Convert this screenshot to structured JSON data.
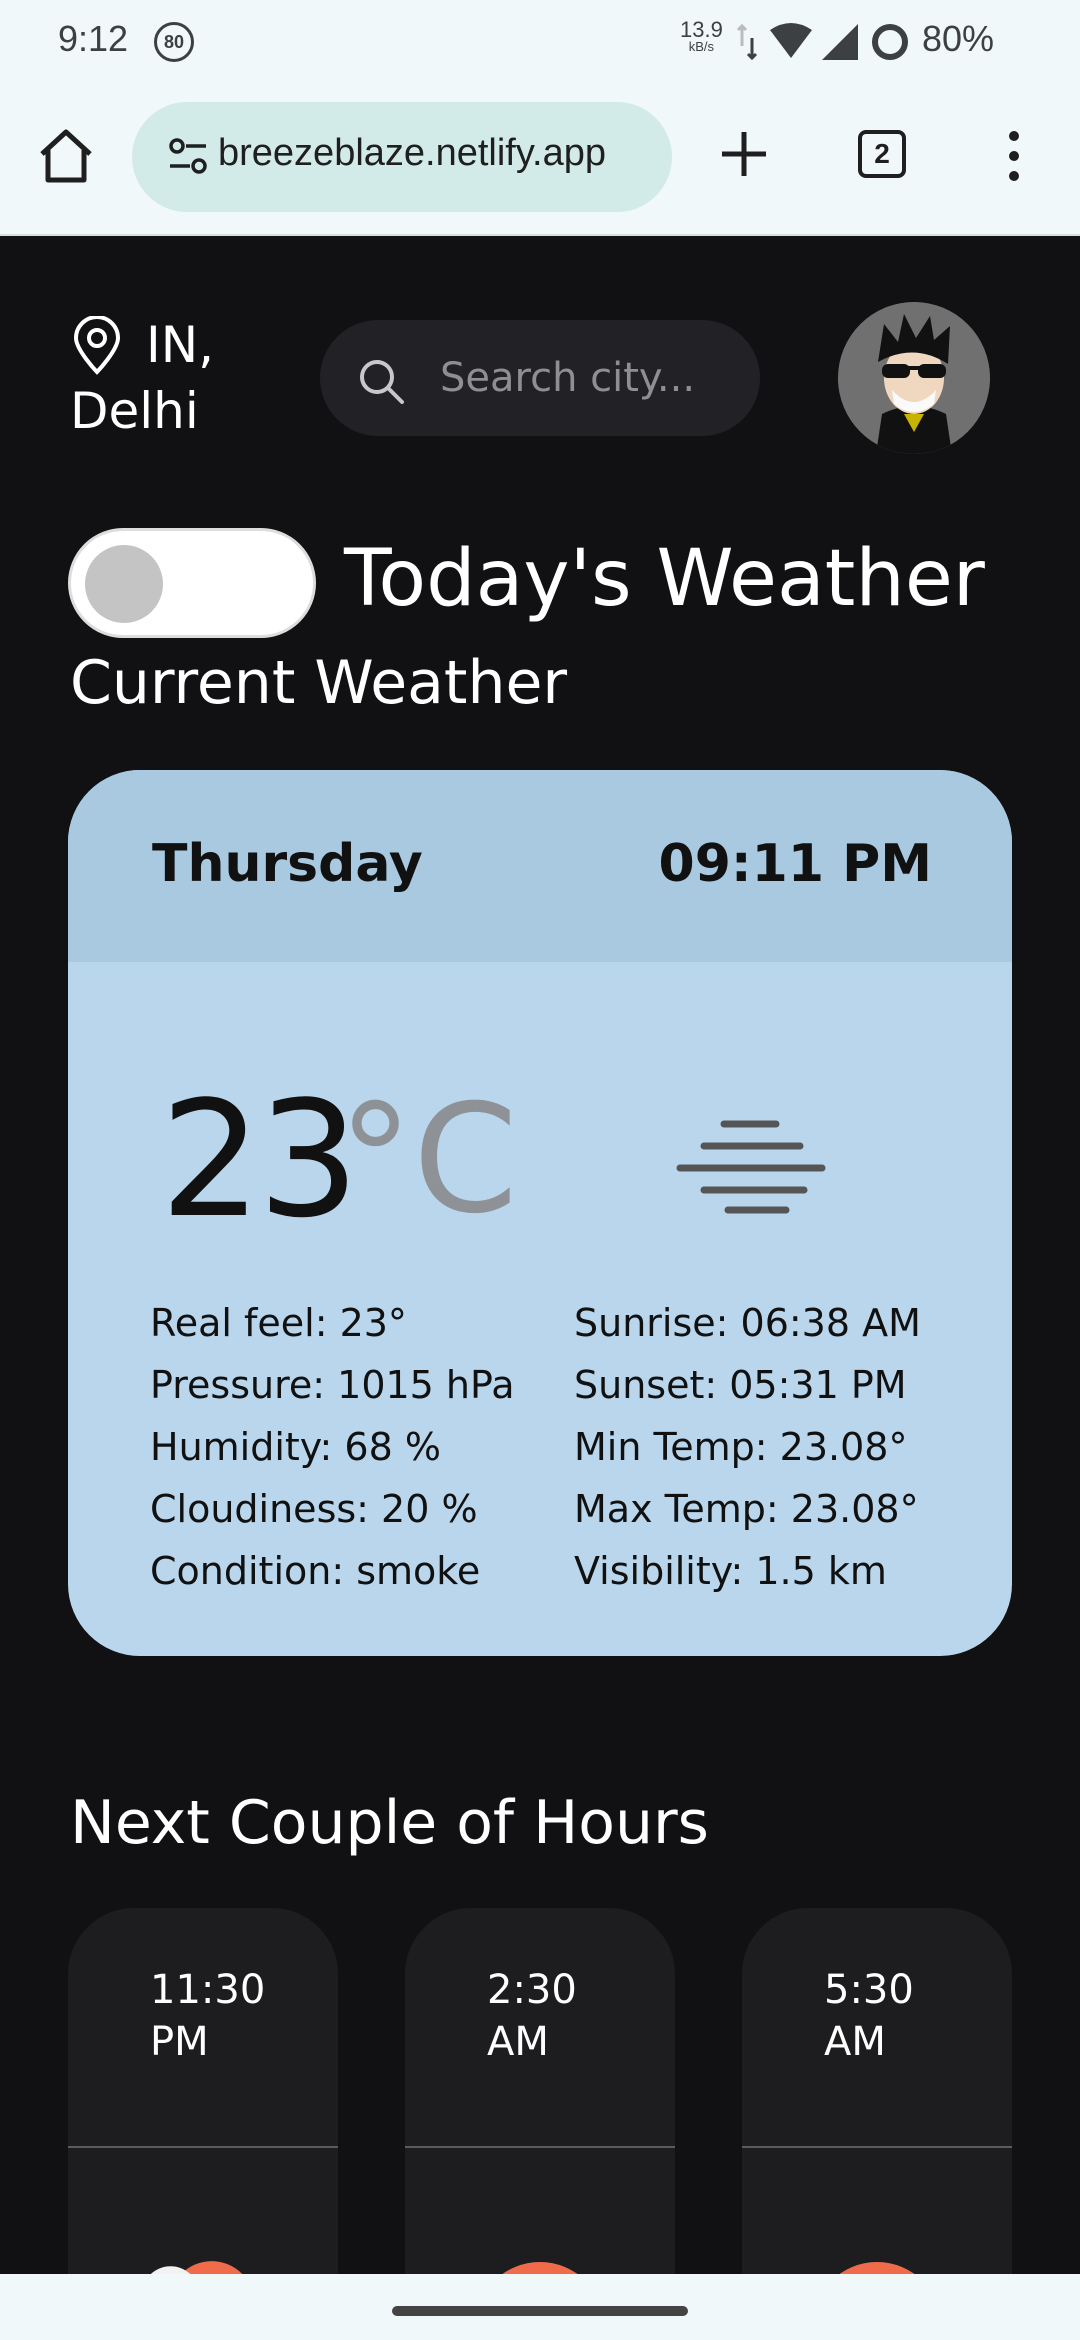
{
  "status_bar": {
    "time": "9:12",
    "notification_badge": "80",
    "net_speed": "13.9",
    "net_speed_unit": "kB/s",
    "battery": "80%"
  },
  "browser": {
    "url": "breezeblaze.netlify.app",
    "tab_count": "2"
  },
  "header": {
    "location": "IN, Delhi",
    "search_placeholder": "Search city..."
  },
  "titles": {
    "today": "Today's Weather",
    "current": "Current Weather"
  },
  "current": {
    "day": "Thursday",
    "time": "09:11 PM",
    "temperature": "23",
    "unit": "°C",
    "icon": "haze-icon",
    "left": [
      "Real feel: 23°",
      "Pressure: 1015 hPa",
      "Humidity: 68 %",
      "Cloudiness: 20 %",
      "Condition: smoke"
    ],
    "right": [
      "Sunrise: 06:38 AM",
      "Sunset: 05:31 PM",
      "Min Temp: 23.08°",
      "Max Temp: 23.08°",
      "Visibility: 1.5 km"
    ]
  },
  "forecast": {
    "title": "Next Couple of Hours",
    "hours": [
      {
        "time": "11:30 PM",
        "icon": "cloud-sun-icon"
      },
      {
        "time": "2:30 AM",
        "icon": "sun-icon"
      },
      {
        "time": "5:30 AM",
        "icon": "sun-icon"
      }
    ]
  },
  "colors": {
    "background": "#111114",
    "card": "#b9d6ec",
    "card_header": "#a9c9e0",
    "sun": "#ef6b4a"
  }
}
